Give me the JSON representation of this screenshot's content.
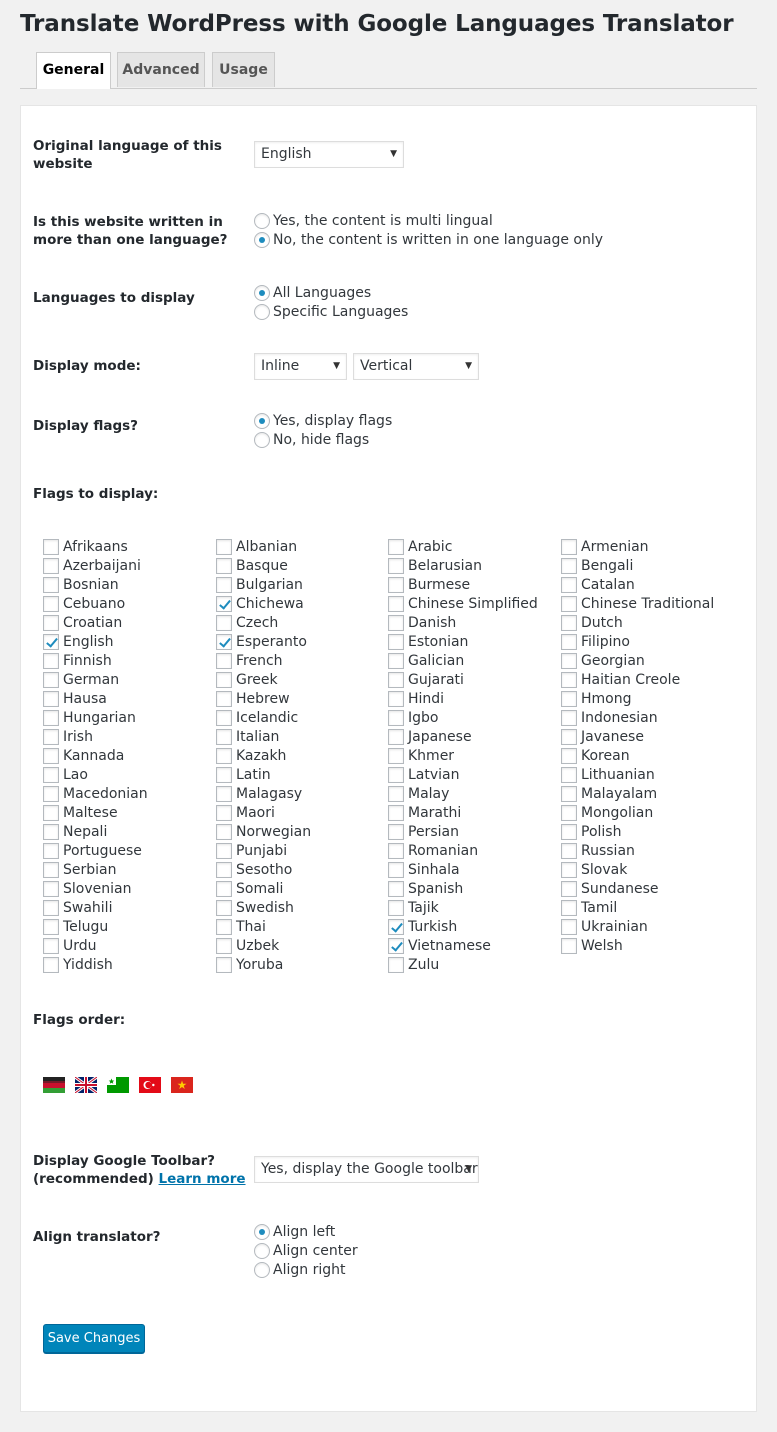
{
  "page": {
    "title": "Translate WordPress with Google Languages Translator"
  },
  "tabs": [
    {
      "label": "General",
      "active": true
    },
    {
      "label": "Advanced",
      "active": false
    },
    {
      "label": "Usage",
      "active": false
    }
  ],
  "original_language": {
    "label": "Original language of this website",
    "value": "English"
  },
  "multilingual": {
    "label": "Is this website written in more than one language?",
    "options": [
      {
        "label": "Yes, the content is multi lingual",
        "selected": false
      },
      {
        "label": "No, the content is written in one language only",
        "selected": true
      }
    ]
  },
  "languages_display": {
    "label": "Languages to display",
    "options": [
      {
        "label": "All Languages",
        "selected": true
      },
      {
        "label": "Specific Languages",
        "selected": false
      }
    ]
  },
  "display_mode": {
    "label": "Display mode:",
    "mode_value": "Inline",
    "orientation_value": "Vertical"
  },
  "display_flags": {
    "label": "Display flags?",
    "options": [
      {
        "label": "Yes, display flags",
        "selected": true
      },
      {
        "label": "No, hide flags",
        "selected": false
      }
    ]
  },
  "flags_to_display": {
    "label": "Flags to display:",
    "columns": [
      [
        {
          "name": "Afrikaans",
          "checked": false
        },
        {
          "name": "Azerbaijani",
          "checked": false
        },
        {
          "name": "Bosnian",
          "checked": false
        },
        {
          "name": "Cebuano",
          "checked": false
        },
        {
          "name": "Croatian",
          "checked": false
        },
        {
          "name": "English",
          "checked": true
        },
        {
          "name": "Finnish",
          "checked": false
        },
        {
          "name": "German",
          "checked": false
        },
        {
          "name": "Hausa",
          "checked": false
        },
        {
          "name": "Hungarian",
          "checked": false
        },
        {
          "name": "Irish",
          "checked": false
        },
        {
          "name": "Kannada",
          "checked": false
        },
        {
          "name": "Lao",
          "checked": false
        },
        {
          "name": "Macedonian",
          "checked": false
        },
        {
          "name": "Maltese",
          "checked": false
        },
        {
          "name": "Nepali",
          "checked": false
        },
        {
          "name": "Portuguese",
          "checked": false
        },
        {
          "name": "Serbian",
          "checked": false
        },
        {
          "name": "Slovenian",
          "checked": false
        },
        {
          "name": "Swahili",
          "checked": false
        },
        {
          "name": "Telugu",
          "checked": false
        },
        {
          "name": "Urdu",
          "checked": false
        },
        {
          "name": "Yiddish",
          "checked": false
        }
      ],
      [
        {
          "name": "Albanian",
          "checked": false
        },
        {
          "name": "Basque",
          "checked": false
        },
        {
          "name": "Bulgarian",
          "checked": false
        },
        {
          "name": "Chichewa",
          "checked": true
        },
        {
          "name": "Czech",
          "checked": false
        },
        {
          "name": "Esperanto",
          "checked": true
        },
        {
          "name": "French",
          "checked": false
        },
        {
          "name": "Greek",
          "checked": false
        },
        {
          "name": "Hebrew",
          "checked": false
        },
        {
          "name": "Icelandic",
          "checked": false
        },
        {
          "name": "Italian",
          "checked": false
        },
        {
          "name": "Kazakh",
          "checked": false
        },
        {
          "name": "Latin",
          "checked": false
        },
        {
          "name": "Malagasy",
          "checked": false
        },
        {
          "name": "Maori",
          "checked": false
        },
        {
          "name": "Norwegian",
          "checked": false
        },
        {
          "name": "Punjabi",
          "checked": false
        },
        {
          "name": "Sesotho",
          "checked": false
        },
        {
          "name": "Somali",
          "checked": false
        },
        {
          "name": "Swedish",
          "checked": false
        },
        {
          "name": "Thai",
          "checked": false
        },
        {
          "name": "Uzbek",
          "checked": false
        },
        {
          "name": "Yoruba",
          "checked": false
        }
      ],
      [
        {
          "name": "Arabic",
          "checked": false
        },
        {
          "name": "Belarusian",
          "checked": false
        },
        {
          "name": "Burmese",
          "checked": false
        },
        {
          "name": "Chinese Simplified",
          "checked": false
        },
        {
          "name": "Danish",
          "checked": false
        },
        {
          "name": "Estonian",
          "checked": false
        },
        {
          "name": "Galician",
          "checked": false
        },
        {
          "name": "Gujarati",
          "checked": false
        },
        {
          "name": "Hindi",
          "checked": false
        },
        {
          "name": "Igbo",
          "checked": false
        },
        {
          "name": "Japanese",
          "checked": false
        },
        {
          "name": "Khmer",
          "checked": false
        },
        {
          "name": "Latvian",
          "checked": false
        },
        {
          "name": "Malay",
          "checked": false
        },
        {
          "name": "Marathi",
          "checked": false
        },
        {
          "name": "Persian",
          "checked": false
        },
        {
          "name": "Romanian",
          "checked": false
        },
        {
          "name": "Sinhala",
          "checked": false
        },
        {
          "name": "Spanish",
          "checked": false
        },
        {
          "name": "Tajik",
          "checked": false
        },
        {
          "name": "Turkish",
          "checked": true
        },
        {
          "name": "Vietnamese",
          "checked": true
        },
        {
          "name": "Zulu",
          "checked": false
        }
      ],
      [
        {
          "name": "Armenian",
          "checked": false
        },
        {
          "name": "Bengali",
          "checked": false
        },
        {
          "name": "Catalan",
          "checked": false
        },
        {
          "name": "Chinese Traditional",
          "checked": false
        },
        {
          "name": "Dutch",
          "checked": false
        },
        {
          "name": "Filipino",
          "checked": false
        },
        {
          "name": "Georgian",
          "checked": false
        },
        {
          "name": "Haitian Creole",
          "checked": false
        },
        {
          "name": "Hmong",
          "checked": false
        },
        {
          "name": "Indonesian",
          "checked": false
        },
        {
          "name": "Javanese",
          "checked": false
        },
        {
          "name": "Korean",
          "checked": false
        },
        {
          "name": "Lithuanian",
          "checked": false
        },
        {
          "name": "Malayalam",
          "checked": false
        },
        {
          "name": "Mongolian",
          "checked": false
        },
        {
          "name": "Polish",
          "checked": false
        },
        {
          "name": "Russian",
          "checked": false
        },
        {
          "name": "Slovak",
          "checked": false
        },
        {
          "name": "Sundanese",
          "checked": false
        },
        {
          "name": "Tamil",
          "checked": false
        },
        {
          "name": "Ukrainian",
          "checked": false
        },
        {
          "name": "Welsh",
          "checked": false
        }
      ]
    ]
  },
  "flags_order": {
    "label": "Flags order:",
    "flags": [
      "chichewa-flag-icon",
      "english-flag-icon",
      "esperanto-flag-icon",
      "turkish-flag-icon",
      "vietnamese-flag-icon"
    ]
  },
  "google_toolbar": {
    "label": "Display Google Toolbar?",
    "label_line2": "(recommended)",
    "link": "Learn more",
    "value": "Yes, display the Google toolbar"
  },
  "align": {
    "label": "Align translator?",
    "options": [
      {
        "label": "Align left",
        "selected": true
      },
      {
        "label": "Align center",
        "selected": false
      },
      {
        "label": "Align right",
        "selected": false
      }
    ]
  },
  "save_label": "Save Changes",
  "colors": {
    "accent": "#1e8cbe",
    "button": "#0085ba",
    "link": "#0073aa"
  }
}
